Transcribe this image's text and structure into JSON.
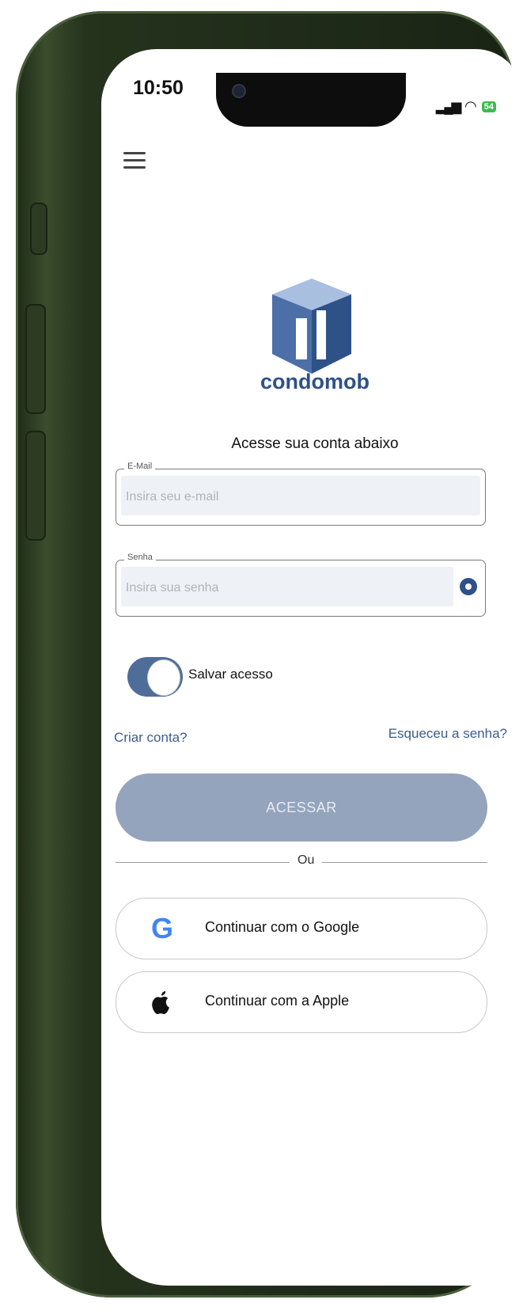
{
  "status_bar": {
    "time": "10:50",
    "battery": "54"
  },
  "brand": {
    "name": "condomob"
  },
  "login": {
    "subtitle": "Acesse sua conta abaixo",
    "email_label": "E-Mail",
    "email_placeholder": "Insira seu e-mail",
    "password_label": "Senha",
    "password_placeholder": "Insira sua senha",
    "save_access_label": "Salvar acesso",
    "save_access_enabled": true,
    "create_account": "Criar conta?",
    "forgot_password": "Esqueceu a senha?",
    "submit": "ACESSAR",
    "divider": "Ou",
    "google": "Continuar com o Google",
    "apple": "Continuar com a Apple"
  },
  "colors": {
    "brand": "#2e5188",
    "button": "#94a4bd",
    "toggle": "#4f6d99",
    "link": "#3c5d8c"
  },
  "icons": [
    "menu-icon",
    "eye-icon",
    "google-icon",
    "apple-icon",
    "wifi-icon",
    "signal-icon",
    "battery-icon"
  ]
}
